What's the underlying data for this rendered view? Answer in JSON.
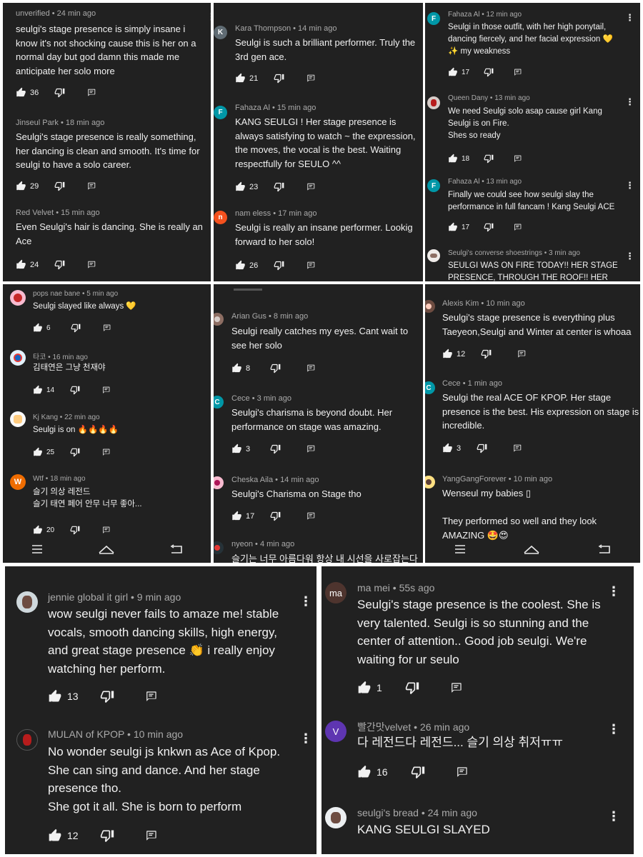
{
  "panels": [
    {
      "comments": [
        {
          "author": "unverified",
          "time": "24 min ago",
          "text": "seulgi's stage presence is simply insane i know it's not shocking cause this is her on a normal day but god damn this made me anticipate her solo more",
          "likes": "36"
        },
        {
          "author": "Jinseul Park",
          "time": "18 min ago",
          "text": "Seulgi's stage presence is really something, her dancing is clean and smooth. It's time for seulgi to have a solo career.",
          "likes": "29"
        },
        {
          "author": "Red Velvet",
          "time": "15 min ago",
          "text": "Even Seulgi's hair is dancing. She is really an Ace",
          "likes": "24"
        }
      ]
    },
    {
      "comments": [
        {
          "author": "Kara Thompson",
          "time": "14 min ago",
          "text": "Seulgi is such a brilliant performer. Truly the 3rd gen ace.",
          "likes": "21",
          "initial": "K",
          "color": "#5f6b73"
        },
        {
          "author": "Fahaza Al",
          "time": "15 min ago",
          "text": "KANG SEULGI ! Her stage presence is always satisfying to watch ~ the expression, the moves, the vocal is the best. Waiting respectfully for SEULO ^^",
          "likes": "23",
          "initial": "F",
          "color": "#0097a7"
        },
        {
          "author": "nam eless",
          "time": "17 min ago",
          "text": "Seulgi is really an insane performer. Lookig forward to her solo!",
          "likes": "26",
          "initial": "n",
          "color": "#f4511e"
        }
      ]
    },
    {
      "comments": [
        {
          "author": "Fahaza Al",
          "time": "12 min ago",
          "text": "Seulgi in those outfit, with her high ponytail, dancing fiercely, and her facial expression 💛\n✨ my weakness",
          "likes": "17",
          "initial": "F",
          "color": "#0097a7"
        },
        {
          "author": "Queen Dany",
          "time": "13 min ago",
          "text": "We need Seulgi solo asap cause girl Kang Seulgi is on Fire.\nShes so ready",
          "likes": "18"
        },
        {
          "author": "Fahaza Al",
          "time": "13 min ago",
          "text": "Finally we could see how seulgi slay the performance in full fancam ! Kang Seulgi ACE",
          "likes": "17",
          "initial": "F",
          "color": "#0097a7"
        },
        {
          "author": "Seulgi's converse shoestrings",
          "time": "3 min ago",
          "text": "SEULGI WAS ON FIRE TODAY!! HER STAGE PRESENCE, THROUGH THE ROOF!! HER",
          "likes": ""
        }
      ]
    },
    {
      "comments": [
        {
          "author": "pops nae bane",
          "time": "5 min ago",
          "text": "Seulgi slayed like always 💛",
          "likes": "6"
        },
        {
          "author": "타코",
          "time": "16 min ago",
          "text": "김태연은 그냥 천재야",
          "likes": "14"
        },
        {
          "author": "Kj Kang",
          "time": "22 min ago",
          "text": "Seulgi is on 🔥🔥🔥🔥",
          "likes": "25"
        },
        {
          "author": "Wtf",
          "time": "18 min ago",
          "text": "슬기 의상 레전드\n슬기 태연 페어 안무 너무 좋아...",
          "likes": "20",
          "initial": "W",
          "color": "#ef6c00"
        }
      ]
    },
    {
      "comments": [
        {
          "author": "Arian Gus",
          "time": "8 min ago",
          "text": "Seulgi really catches my eyes. Cant wait to see her solo",
          "likes": "8"
        },
        {
          "author": "Cece",
          "time": "3 min ago",
          "text": "Seulgi's charisma is beyond doubt. Her performance on stage was amazing.",
          "likes": "3",
          "initial": "C",
          "color": "#0097a7"
        },
        {
          "author": "Cheska Aila",
          "time": "14 min ago",
          "text": "Seulgi's Charisma on Stage tho",
          "likes": "17"
        },
        {
          "author": "nyeon",
          "time": "4 min ago",
          "text": "슬기는 너무 아름다워 항상 내 시선을 사로잡는다",
          "likes": ""
        }
      ]
    },
    {
      "comments": [
        {
          "author": "Alexis Kim",
          "time": "10 min ago",
          "text": "Seulgi's stage presence is everything plus Taeyeon,Seulgi and  Winter at center is whoaa",
          "likes": "12"
        },
        {
          "author": "Cece",
          "time": "1 min ago",
          "text": "Seulgi the real ACE OF KPOP. Her stage presence is the best. His expression on stage is incredible.",
          "likes": "3",
          "initial": "C",
          "color": "#0097a7"
        },
        {
          "author": "YangGangForever",
          "time": "10 min ago",
          "text": "Wenseul my babies ▯\n\nThey performed so well and they look AMAZING 🤩😍",
          "likes": ""
        }
      ]
    },
    {
      "comments": [
        {
          "author": "jennie global it girl",
          "time": "9 min ago",
          "text": "wow seulgi never fails to amaze me! stable vocals, smooth dancing skills, high energy, and great stage presence 👏  i really enjoy watching her perform.",
          "likes": "13"
        },
        {
          "author": "MULAN of KPOP",
          "time": "10 min ago",
          "text": "No wonder seulgi js knkwn as Ace of Kpop.\nShe can sing and dance. And her stage presence tho.\nShe got it all. She is born to perform",
          "likes": "12"
        }
      ]
    },
    {
      "comments": [
        {
          "author": "ma mei",
          "time": "55s ago",
          "text": "Seulgi's stage presence is the coolest. She is very talented. Seulgi is so stunning and the center of attention.. Good job seulgi. We're waiting for ur seulo",
          "likes": "1",
          "initial": "ma",
          "color": "#4e342e"
        },
        {
          "author": "빨간맛velvet",
          "time": "26 min ago",
          "text": "다 레전드다 레전드... 슬기 의상 취저ㅠㅠ",
          "likes": "16",
          "initial": "V",
          "color": "#5e35b1"
        },
        {
          "author": "seulgi's bread",
          "time": "24 min ago",
          "text": "KANG SEULGI SLAYED",
          "likes": ""
        }
      ]
    }
  ],
  "icons": {
    "like": "thumbs-up-icon",
    "dislike": "thumbs-down-icon",
    "reply": "reply-icon",
    "menu": "kebab-menu-icon",
    "nav_recent": "recent-apps-icon",
    "nav_home": "home-icon",
    "nav_back": "back-icon"
  },
  "colors": {
    "background": "#212121",
    "meta": "#aaaaaa",
    "text": "#f1f1f1",
    "divider": "#ffffff"
  }
}
